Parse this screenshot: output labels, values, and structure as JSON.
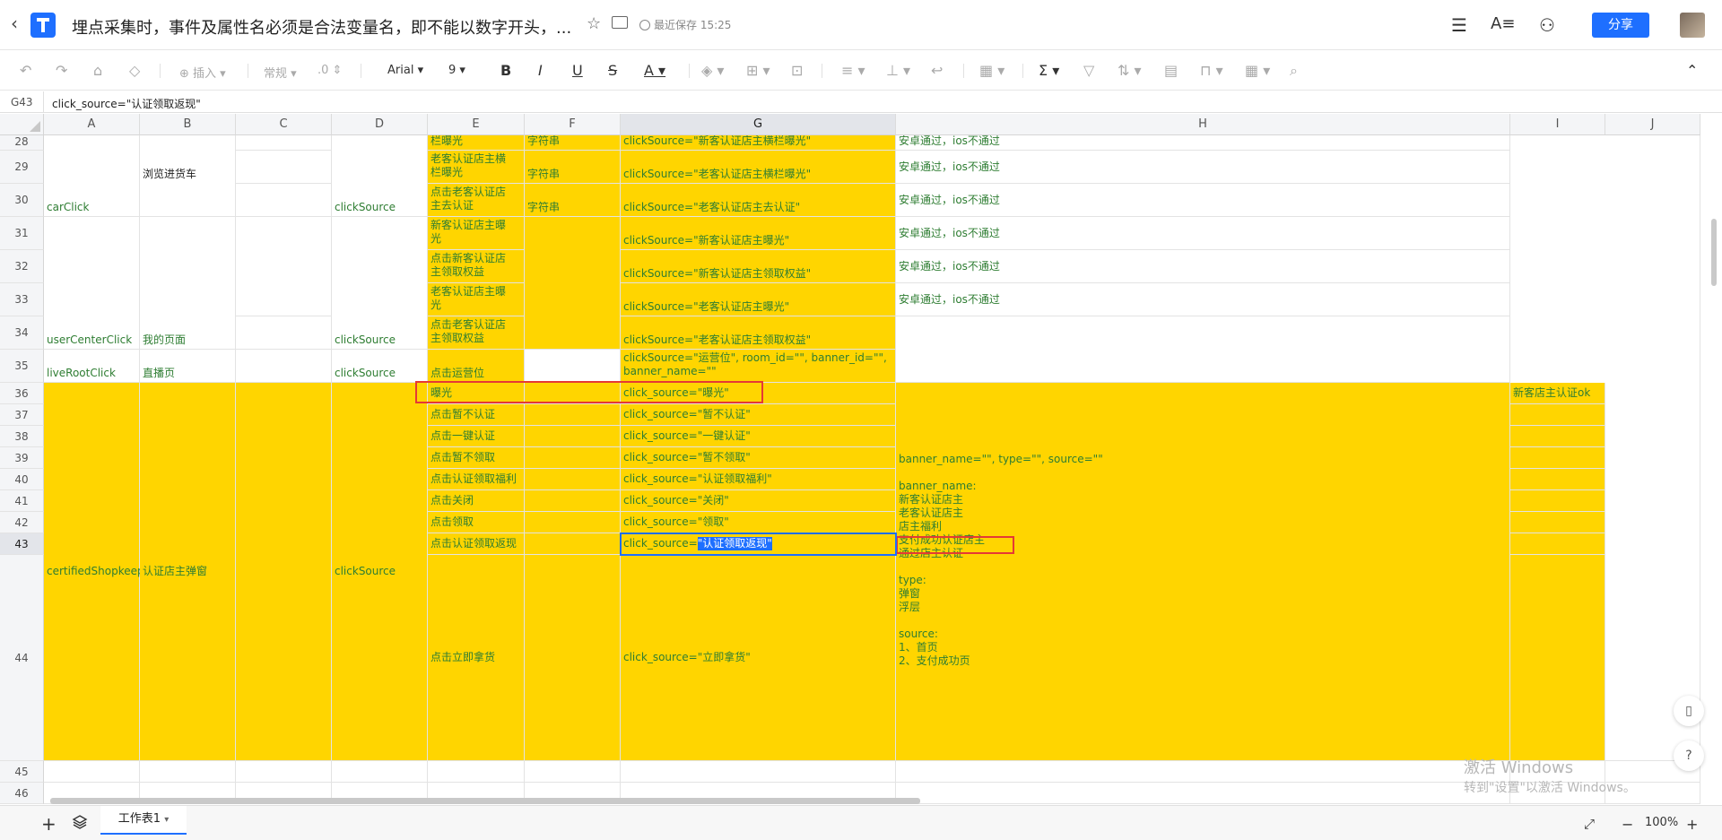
{
  "titlebar": {
    "title": "埋点采集时，事件及属性名必须是合法变量名，即不能以数字开头，...",
    "saved": "最近保存 15:25",
    "share": "分享"
  },
  "toolbar": {
    "insert": "插入",
    "format": "常规",
    "decimal": ".0",
    "font": "Arial",
    "size": "9"
  },
  "formula_bar": {
    "cell_ref": "G43",
    "content": "click_source=\"认证领取返现\""
  },
  "columns": [
    "A",
    "B",
    "C",
    "D",
    "E",
    "F",
    "G",
    "H",
    "I",
    "J"
  ],
  "rows": [
    "28",
    "29",
    "30",
    "31",
    "32",
    "33",
    "34",
    "35",
    "36",
    "37",
    "38",
    "39",
    "40",
    "41",
    "42",
    "43",
    "44",
    "45",
    "46"
  ],
  "cells": {
    "E28": "栏曝光",
    "F28": "字符串",
    "G28": "clickSource=\"新客认证店主横栏曝光\"",
    "H28": "安卓通过，ios不通过",
    "B29": "浏览进货车",
    "E29": "老客认证店主横\n栏曝光",
    "F29": "字符串",
    "G29": "clickSource=\"老客认证店主横栏曝光\"",
    "H29": "安卓通过，ios不通过",
    "A30": "carClick",
    "D30": "clickSource",
    "E30": "点击老客认证店\n主去认证",
    "F30": "字符串",
    "G30": "clickSource=\"老客认证店主去认证\"",
    "H30": "安卓通过，ios不通过",
    "E31": "新客认证店主曝\n光",
    "G31": "clickSource=\"新客认证店主曝光\"",
    "H31": "安卓通过，ios不通过",
    "E32": "点击新客认证店\n主领取权益",
    "G32": "clickSource=\"新客认证店主领取权益\"",
    "H32": "安卓通过，ios不通过",
    "E33": "老客认证店主曝\n光",
    "G33": "clickSource=\"老客认证店主曝光\"",
    "H33": "安卓通过，ios不通过",
    "A34": "userCenterClick",
    "B34": "我的页面",
    "D34": "clickSource",
    "E34": "点击老客认证店\n主领取权益",
    "G34": "clickSource=\"老客认证店主领取权益\"",
    "A35": "liveRootClick",
    "B35": "直播页",
    "D35": "clickSource",
    "E35": "点击运营位",
    "G35": "clickSource=\"运营位\", room_id=\"\", banner_id=\"\",\nbanner_name=\"\"",
    "E36": "曝光",
    "G36": "click_source=\"曝光\"",
    "I36": "新客店主认证ok",
    "E37": "点击暂不认证",
    "G37": "click_source=\"暂不认证\"",
    "E38": "点击一键认证",
    "G38": "click_source=\"一键认证\"",
    "E39": "点击暂不领取",
    "G39": "click_source=\"暂不领取\"",
    "E40": "点击认证领取福利",
    "G40": "click_source=\"认证领取福利\"",
    "E41": "点击关闭",
    "G41": "click_source=\"关闭\"",
    "E42": "点击领取",
    "G42": "click_source=\"领取\"",
    "E43": "点击认证领取返现",
    "G43_prefix": "click_source=",
    "G43_sel": "\"认证领取返现\"",
    "A36": "certifiedShopkeeper",
    "B36": "认证店主弹窗",
    "D36": "clickSource",
    "E44": "点击立即拿货",
    "G44": "click_source=\"立即拿货\"",
    "H36": "banner_name=\"\", type=\"\", source=\"\"\n\nbanner_name:\n新客认证店主\n老客认证店主\n店主福利\n支付成功认证店主\n通过店主认证\n\ntype:\n弹窗\n浮层\n\nsource:\n1、首页\n2、支付成功页"
  },
  "sheet_tab": "工作表1",
  "zoom": "100%",
  "watermark": {
    "line1": "激活 Windows",
    "line2": "转到\"设置\"以激活 Windows。"
  },
  "colors": {
    "yellow": "#ffd500",
    "green_text": "#2e7d32",
    "accent": "#1e6fff",
    "red": "#e53935"
  }
}
